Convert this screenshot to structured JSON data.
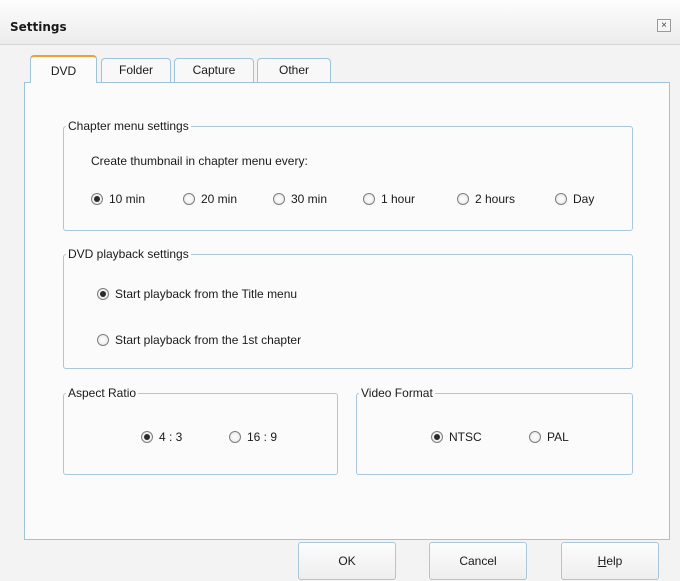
{
  "window": {
    "title": "Settings",
    "close_glyph": "×"
  },
  "tabs": [
    {
      "label": "DVD",
      "active": true
    },
    {
      "label": "Folder",
      "active": false
    },
    {
      "label": "Capture",
      "active": false
    },
    {
      "label": "Other",
      "active": false
    }
  ],
  "chapter_menu": {
    "legend": "Chapter menu settings",
    "prompt": "Create thumbnail in chapter menu every:",
    "options": [
      {
        "label": "10 min",
        "selected": true
      },
      {
        "label": "20 min",
        "selected": false
      },
      {
        "label": "30 min",
        "selected": false
      },
      {
        "label": "1 hour",
        "selected": false
      },
      {
        "label": "2 hours",
        "selected": false
      },
      {
        "label": "Day",
        "selected": false
      }
    ]
  },
  "playback": {
    "legend": "DVD playback settings",
    "options": [
      {
        "label": "Start playback from the Title menu",
        "selected": true
      },
      {
        "label": "Start playback from the 1st chapter",
        "selected": false
      }
    ]
  },
  "aspect_ratio": {
    "legend": "Aspect Ratio",
    "options": [
      {
        "label": "4 : 3",
        "selected": true
      },
      {
        "label": "16 : 9",
        "selected": false
      }
    ]
  },
  "video_format": {
    "legend": "Video Format",
    "options": [
      {
        "label": "NTSC",
        "selected": true
      },
      {
        "label": "PAL",
        "selected": false
      }
    ]
  },
  "buttons": {
    "ok": "OK",
    "cancel": "Cancel",
    "help_mnemonic": "H",
    "help_rest": "elp"
  },
  "colors": {
    "active_tab_accent": "#f0a030",
    "border_accent": "#9fc3d8"
  }
}
